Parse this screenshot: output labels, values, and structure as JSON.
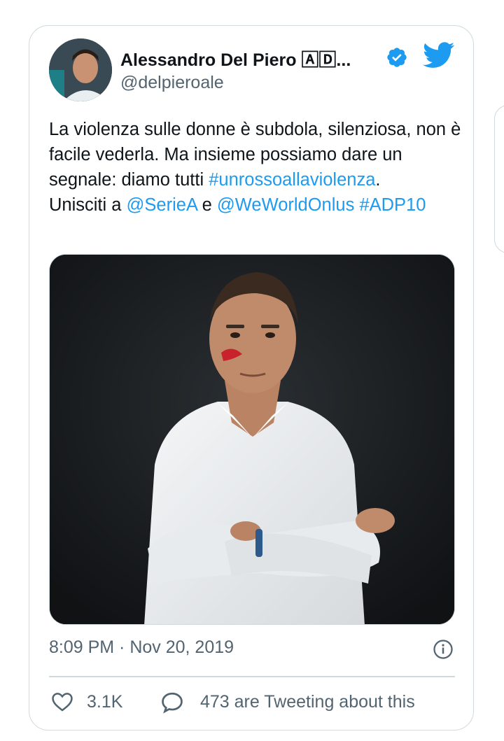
{
  "tweet": {
    "author_name": "Alessandro Del Piero 🄰🄳...",
    "author_handle": "@delpieroale",
    "text": {
      "line1": "La violenza sulle donne è subdola, silenziosa, non è facile vederla. Ma insieme possiamo dare un segnale: diamo tutti ",
      "hashtag1": "#unrossoallaviolenza",
      "after_hashtag": ".",
      "line2_prefix": "Unisciti a ",
      "mention1": "@SerieA",
      "and_word": " e ",
      "mention2": "@WeWorldOnlus",
      "space": " ",
      "hashtag2": "#ADP10"
    },
    "timestamp": "8:09 PM · Nov 20, 2019",
    "likes": "3.1K",
    "tweeting": "473 are Tweeting about this"
  },
  "icons": {
    "verified": "verified-badge-icon",
    "brand": "twitter-bird-icon",
    "info": "info-icon",
    "like": "heart-icon",
    "reply": "speech-bubble-icon"
  },
  "colors": {
    "link": "#1d9bf0",
    "secondary_text": "#536471",
    "border": "#cfd9de"
  }
}
